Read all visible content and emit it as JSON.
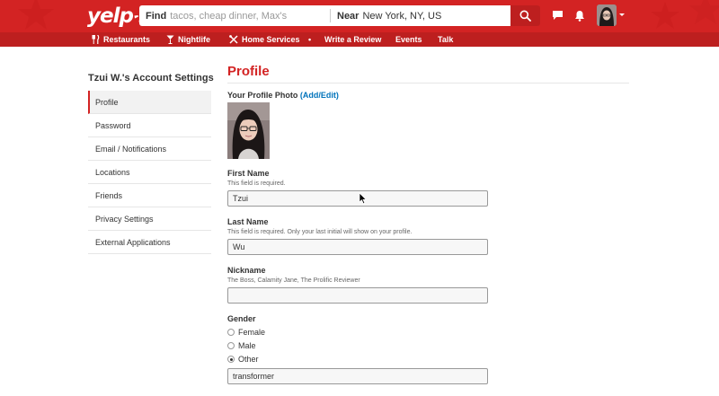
{
  "header": {
    "logo_text": "yelp",
    "search": {
      "find_label": "Find",
      "find_placeholder": "tacos, cheap dinner, Max's",
      "near_label": "Near",
      "near_value": "New York, NY, US"
    },
    "icons": [
      "search-icon",
      "messages-icon",
      "notifications-icon",
      "avatar"
    ]
  },
  "nav": {
    "items": [
      {
        "label": "Restaurants",
        "icon": "fork-knife-icon"
      },
      {
        "label": "Nightlife",
        "icon": "cocktail-icon"
      },
      {
        "label": "Home Services",
        "icon": "tools-icon"
      },
      {
        "label": "Write a Review"
      },
      {
        "label": "Events"
      },
      {
        "label": "Talk"
      }
    ]
  },
  "sidebar": {
    "title": "Tzui W.'s Account Settings",
    "items": [
      {
        "label": "Profile",
        "active": true
      },
      {
        "label": "Password"
      },
      {
        "label": "Email / Notifications"
      },
      {
        "label": "Locations"
      },
      {
        "label": "Friends"
      },
      {
        "label": "Privacy Settings"
      },
      {
        "label": "External Applications"
      }
    ]
  },
  "main": {
    "title": "Profile",
    "photo_label": "Your Profile Photo",
    "photo_link": "(Add/Edit)",
    "fields": {
      "first_name": {
        "label": "First Name",
        "help": "This field is required.",
        "value": "Tzui"
      },
      "last_name": {
        "label": "Last Name",
        "help": "This field is required. Only your last initial will show on your profile.",
        "value": "Wu"
      },
      "nickname": {
        "label": "Nickname",
        "help": "The Boss, Calamity Jane, The Prolific Reviewer",
        "value": ""
      },
      "gender": {
        "label": "Gender",
        "options": [
          "Female",
          "Male",
          "Other"
        ],
        "selected": "Other",
        "other_value": "transformer"
      }
    }
  },
  "colors": {
    "brand_red": "#d32323",
    "nav_red": "#bd1f1f",
    "link_blue": "#0073bb"
  }
}
